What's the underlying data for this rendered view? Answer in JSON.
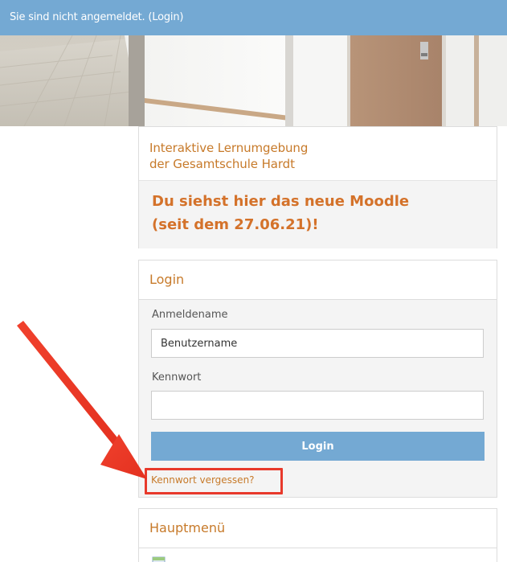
{
  "topbar": {
    "status_text": "Sie sind nicht angemeldet. (",
    "login_link": "Login",
    "status_close": ")"
  },
  "site_info": {
    "title_line1": "Interaktive Lernumgebung",
    "title_line2": "der Gesamtschule Hardt",
    "headline_line1": "Du siehst hier das neue Moodle",
    "headline_line2": "(seit dem 27.06.21)!"
  },
  "login_block": {
    "title": "Login",
    "username_label": "Anmeldename",
    "username_placeholder": "Benutzername",
    "password_label": "Kennwort",
    "password_value": "",
    "submit_label": "Login",
    "forgot_password": "Kennwort vergessen?"
  },
  "main_menu": {
    "title": "Hauptmenü",
    "first_item_icon": "document-icon"
  },
  "colors": {
    "topbar": "#74a9d3",
    "accent_orange": "#c77a2a",
    "headline_orange": "#d4722a",
    "button": "#74a9d3",
    "annotation_red": "#e8392b"
  }
}
